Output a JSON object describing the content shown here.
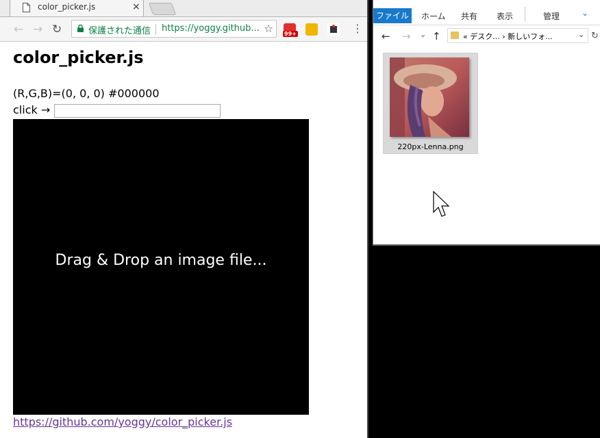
{
  "browser": {
    "tab_title": "color_picker.js",
    "close_glyph": "×",
    "security_label": "保護された通信",
    "url": "https://yoggy.github...",
    "badge_count": "99+",
    "menu_glyph": "⋮",
    "star_glyph": "☆",
    "back_glyph": "←",
    "forward_glyph": "→",
    "reload_glyph": "↻"
  },
  "page": {
    "title": "color_picker.js",
    "rgb_readout": "(R,G,B)=(0, 0, 0) #000000",
    "click_label": "click →",
    "color_input_value": "",
    "canvas_bg": "#000000",
    "drop_text": "Drag & Drop an image file...",
    "repo_link": "https://github.com/yoggy/color_picker.js"
  },
  "explorer": {
    "tabs": [
      "ファイル",
      "ホーム",
      "共有",
      "表示",
      "管理"
    ],
    "path": "« デスク... › 新しいフォ...",
    "back_glyph": "←",
    "forward_glyph": "→",
    "dropdown_glyph": "⌄",
    "up_glyph": "↑",
    "file_name": "220px-Lenna.png",
    "accent": "#1979ca"
  },
  "colors": {
    "secure_green": "#0b8043",
    "link_visited": "#663399",
    "badge_red": "#d20000"
  }
}
